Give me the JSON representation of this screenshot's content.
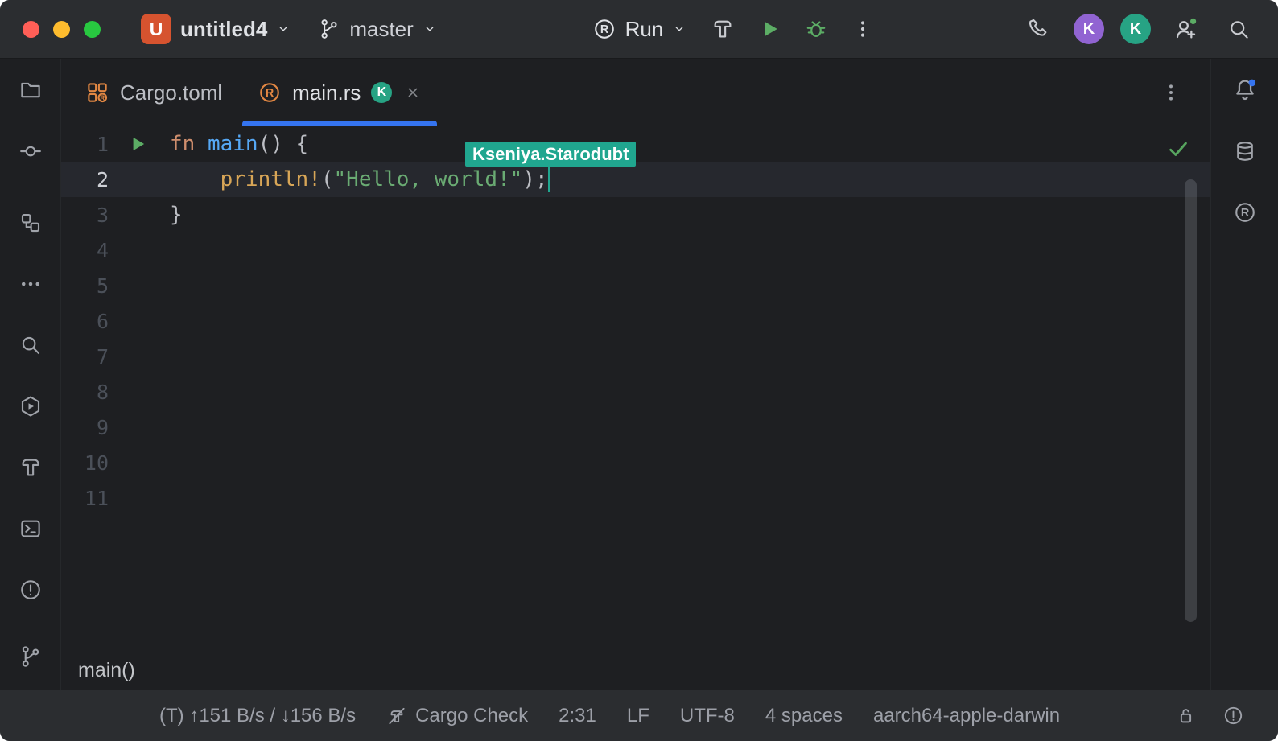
{
  "colors": {
    "accent_blue": "#3574f0",
    "collab_teal": "#20a68f",
    "run_green": "#5cad65",
    "rust_orange": "#e28743",
    "project_badge": "#d6532f",
    "avatar_purple": "#9164d2",
    "avatar_green": "#27a384",
    "keyword": "#cf8e6d",
    "function_name": "#56a8f5",
    "macro": "#d8a657",
    "string": "#6aab73",
    "plain_code": "#bcbec4"
  },
  "titlebar": {
    "project_initial": "U",
    "project_name": "untitled4",
    "branch_name": "master",
    "run_config_label": "Run",
    "avatars": [
      {
        "initial": "K",
        "color": "#9164d2"
      },
      {
        "initial": "K",
        "color": "#27a384"
      }
    ]
  },
  "tabs": [
    {
      "label": "Cargo.toml",
      "active": false
    },
    {
      "label": "main.rs",
      "active": true,
      "badge": "K"
    }
  ],
  "editor": {
    "collaborator_label": "Kseniya.Starodubt",
    "total_lines": 11,
    "code_lines": [
      {
        "number": 1,
        "run_marker": true,
        "tokens": [
          {
            "type": "keyword",
            "text": "fn "
          },
          {
            "type": "function",
            "text": "main"
          },
          {
            "type": "plain",
            "text": "() {"
          }
        ]
      },
      {
        "number": 2,
        "current": true,
        "caret_col": 30,
        "tokens": [
          {
            "type": "plain",
            "text": "    "
          },
          {
            "type": "macro",
            "text": "println!"
          },
          {
            "type": "plain",
            "text": "("
          },
          {
            "type": "string",
            "text": "\"Hello, world!\""
          },
          {
            "type": "plain",
            "text": ");"
          }
        ]
      },
      {
        "number": 3,
        "tokens": [
          {
            "type": "plain",
            "text": "}"
          }
        ]
      }
    ],
    "breadcrumb": "main()"
  },
  "statusbar": {
    "traffic": "(T) ↑151 B/s / ↓156 B/s",
    "cargo_check": "Cargo Check",
    "caret_position": "2:31",
    "line_separator": "LF",
    "encoding": "UTF-8",
    "indent": "4 spaces",
    "target": "aarch64-apple-darwin"
  }
}
